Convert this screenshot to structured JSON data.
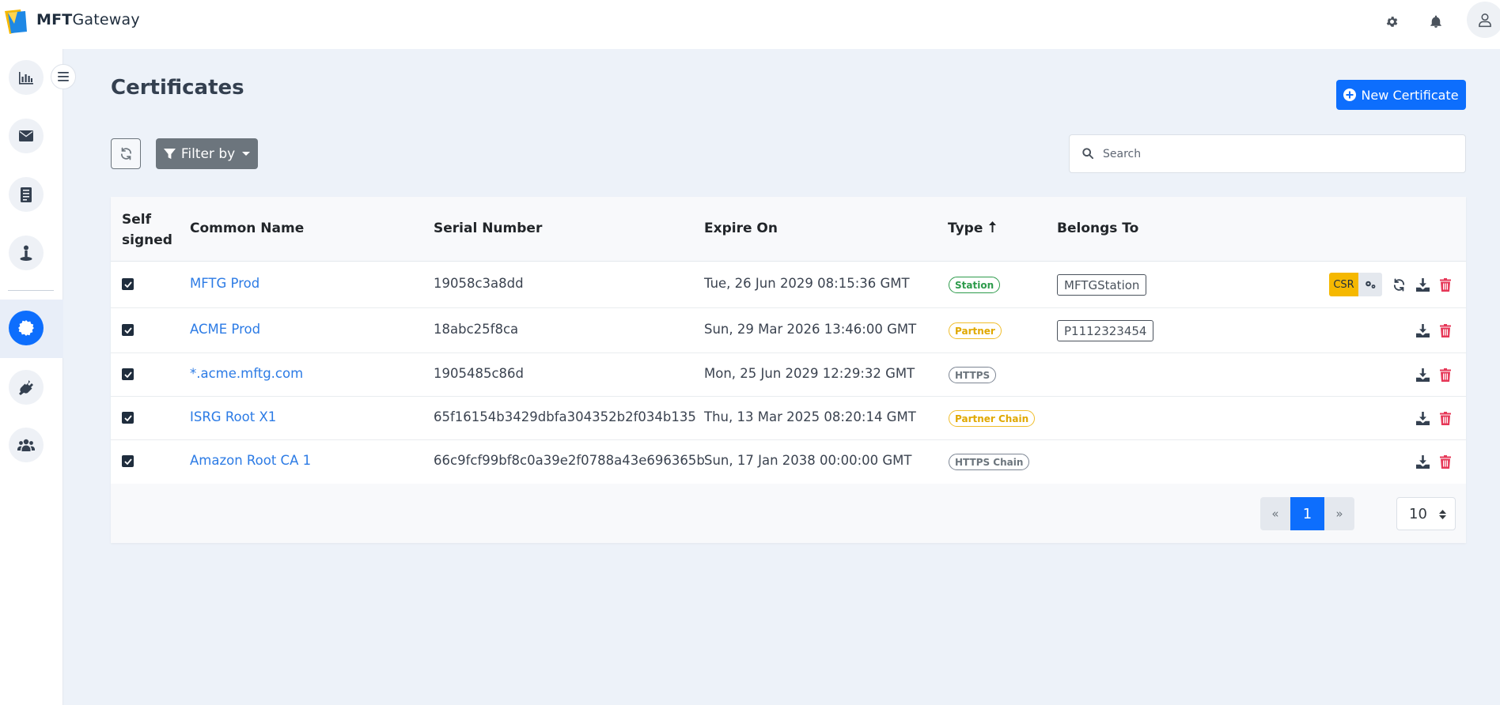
{
  "header": {
    "brand_bold": "MFT",
    "brand_rest": "Gateway",
    "icons": [
      "settings-gear-icon",
      "bell-icon",
      "user-icon"
    ]
  },
  "sidebar": {
    "items": [
      {
        "name": "dashboard",
        "icon": "bar-chart-icon"
      },
      {
        "name": "messages",
        "icon": "envelope-icon"
      },
      {
        "name": "documents",
        "icon": "document-icon"
      },
      {
        "name": "stations",
        "icon": "person-station-icon"
      },
      {
        "name": "certificates",
        "icon": "certificate-badge-icon",
        "active": true
      },
      {
        "name": "connectors",
        "icon": "plug-icon"
      },
      {
        "name": "partners",
        "icon": "users-icon"
      }
    ]
  },
  "page": {
    "title": "Certificates",
    "new_button": "New Certificate",
    "filter_label": "Filter by",
    "search_placeholder": "Search"
  },
  "table": {
    "headers": {
      "self_signed_1": "Self",
      "self_signed_2": "signed",
      "common_name": "Common Name",
      "serial_number": "Serial Number",
      "expire_on": "Expire On",
      "type": "Type",
      "belongs_to": "Belongs To"
    },
    "rows": [
      {
        "self_signed": true,
        "common_name": "MFTG Prod",
        "serial": "19058c3a8dd",
        "expire": "Tue, 26 Jun 2029 08:15:36 GMT",
        "type": "Station",
        "belongs_to": "MFTGStation",
        "csr": "CSR"
      },
      {
        "self_signed": true,
        "common_name": "ACME Prod",
        "serial": "18abc25f8ca",
        "expire": "Sun, 29 Mar 2026 13:46:00 GMT",
        "type": "Partner",
        "belongs_to": "P1112323454"
      },
      {
        "self_signed": true,
        "common_name": "*.acme.mftg.com",
        "serial": "1905485c86d",
        "expire": "Mon, 25 Jun 2029 12:29:32 GMT",
        "type": "HTTPS",
        "belongs_to": ""
      },
      {
        "self_signed": true,
        "common_name": "ISRG Root X1",
        "serial": "65f16154b3429dbfa304352b2f034b135",
        "expire": "Thu, 13 Mar 2025 08:20:14 GMT",
        "type": "Partner Chain",
        "belongs_to": ""
      },
      {
        "self_signed": true,
        "common_name": "Amazon Root CA 1",
        "serial": "66c9fcf99bf8c0a39e2f0788a43e696365b",
        "expire": "Sun, 17 Jan 2038 00:00:00 GMT",
        "type": "HTTPS Chain",
        "belongs_to": ""
      }
    ]
  },
  "pagination": {
    "prev": "«",
    "current": "1",
    "next": "»",
    "per_page": "10"
  },
  "colors": {
    "primary": "#0d6efd",
    "station": "#2d9b4b",
    "partner": "#f0be2c",
    "https": "#7c8593",
    "danger": "#e63757",
    "csr": "#f5b800"
  }
}
